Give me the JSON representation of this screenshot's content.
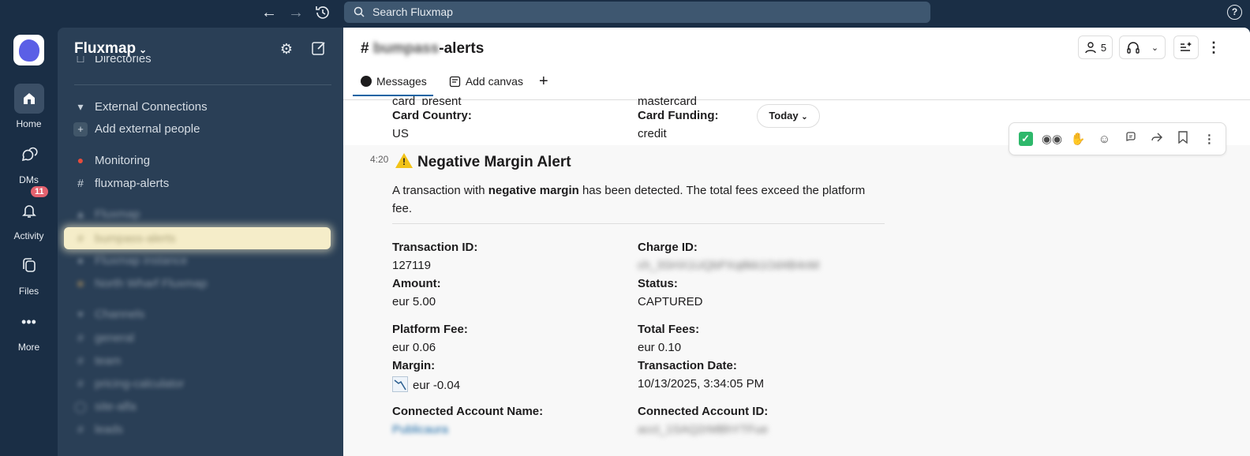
{
  "topbar": {
    "search_placeholder": "Search Fluxmap",
    "help_label": "?"
  },
  "rail": {
    "items": [
      {
        "label": "Home"
      },
      {
        "label": "DMs"
      },
      {
        "label": "Activity",
        "badge": "11"
      },
      {
        "label": "Files"
      },
      {
        "label": "More"
      }
    ]
  },
  "sidebar": {
    "workspace": "Fluxmap",
    "partial_top_item": "Directories",
    "items": [
      {
        "label": "External Connections"
      },
      {
        "label": "Add external people"
      },
      {
        "label": "Monitoring"
      },
      {
        "label": "fluxmap-alerts"
      },
      {
        "label": "Fluxmap"
      },
      {
        "label": "bumpass-alerts"
      },
      {
        "label": "Fluxmap instance"
      },
      {
        "label": "North Wharf Fluxmap"
      },
      {
        "label": "Channels"
      },
      {
        "label": "general"
      },
      {
        "label": "team"
      },
      {
        "label": "pricing-calculator"
      },
      {
        "label": "site-alfa"
      },
      {
        "label": "leads"
      }
    ]
  },
  "channel": {
    "prefix": "#",
    "blurred_part": "bumpass",
    "suffix": "-alerts",
    "members_count": "5",
    "tabs": [
      {
        "label": "Messages"
      },
      {
        "label": "Add canvas"
      }
    ]
  },
  "prev_message": {
    "partial_left": "card_present",
    "partial_right": "mastercard",
    "card_country_label": "Card Country:",
    "card_country_value": "US",
    "card_funding_label": "Card Funding:",
    "card_funding_value": "credit"
  },
  "date_pill": "Today",
  "message": {
    "time": "4:20",
    "title": "Negative Margin Alert",
    "body_pre": "A transaction with ",
    "body_bold": "negative margin",
    "body_post": " has been detected. The total fees exceed the platform",
    "body_line2": "fee.",
    "fields": {
      "transaction_id_label": "Transaction ID:",
      "transaction_id_value": "127119",
      "charge_id_label": "Charge ID:",
      "charge_id_value": "ch_3SHX1UQbPXq8kk1Od4B4nM",
      "amount_label": "Amount:",
      "amount_value": "eur 5.00",
      "status_label": "Status:",
      "status_value": "CAPTURED",
      "platform_fee_label": "Platform Fee:",
      "platform_fee_value": "eur 0.06",
      "total_fees_label": "Total Fees:",
      "total_fees_value": "eur 0.10",
      "margin_label": "Margin:",
      "margin_value": "eur -0.04",
      "transaction_date_label": "Transaction Date:",
      "transaction_date_value": "10/13/2025, 3:34:05 PM",
      "connected_account_name_label": "Connected Account Name:",
      "connected_account_name_value": "Publicaura",
      "connected_account_id_label": "Connected Account ID:",
      "connected_account_id_value": "acct_1SAQ2rMBhYTFue"
    }
  },
  "colors": {
    "sidebar_bg": "#2a3f56",
    "rail_bg": "#1a2e45",
    "accent": "#1264a3",
    "highlight": "#f5edc9"
  }
}
